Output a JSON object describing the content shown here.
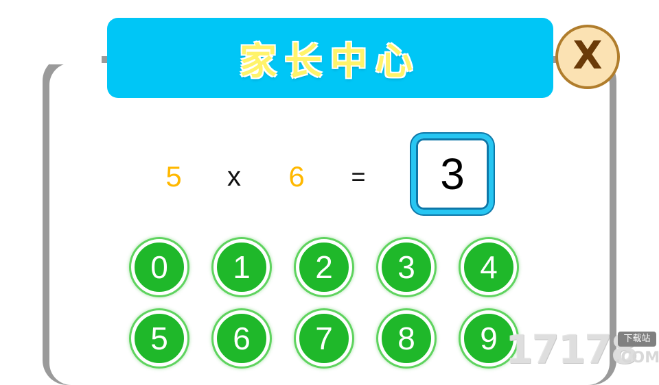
{
  "header": {
    "title": "家长中心"
  },
  "close_button": {
    "label": "X"
  },
  "equation": {
    "operand_a": "5",
    "operator": "x",
    "operand_b": "6",
    "equals": "=",
    "answer": "3"
  },
  "keypad": {
    "keys": [
      "0",
      "1",
      "2",
      "3",
      "4",
      "5",
      "6",
      "7",
      "8",
      "9"
    ]
  },
  "watermark": {
    "number": "17178",
    "badge": "下载站",
    "domain": ".COM"
  },
  "colors": {
    "header_bg": "#00c6f6",
    "title_text": "#fff36a",
    "operand": "#ffb800",
    "key_bg": "#1fb82a",
    "answer_border": "#27c6f2",
    "close_bg": "#fbe2b3",
    "close_border": "#b07d2c"
  }
}
